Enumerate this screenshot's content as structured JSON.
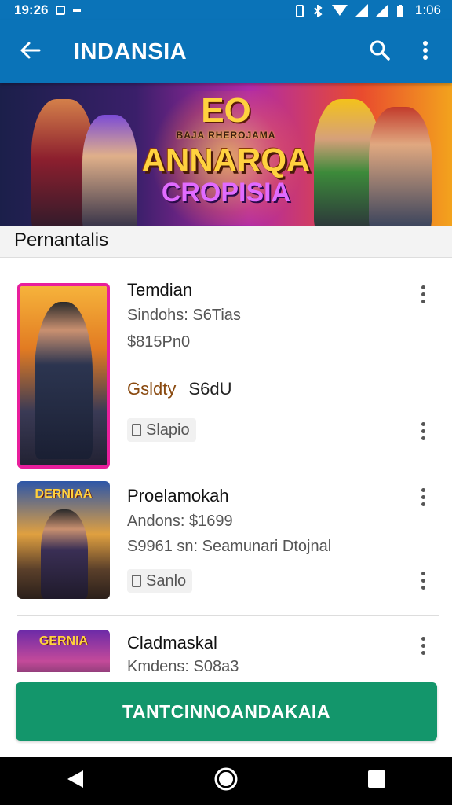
{
  "status_bar": {
    "time_left": "19:26",
    "time_right": "1:06"
  },
  "app_bar": {
    "title": "INDANSIA",
    "back_icon": "arrow-left-icon",
    "search_icon": "search-icon",
    "more_icon": "more-vert-icon"
  },
  "banner": {
    "line1": "EO",
    "line_small": "BAJA RHEROJAMA",
    "line2": "ANNARQA",
    "line3": "CROPISIA"
  },
  "section": {
    "title": "Pernantalis"
  },
  "items": [
    {
      "title": "Temdian",
      "line1": "Sindohs: S6Tias",
      "line2": "$815Pn0",
      "quality_label": "Gsldty",
      "quality_value": "S6dU",
      "chip": "Slapio"
    },
    {
      "thumb_label": "DERNIAA",
      "title": "Proelamokah",
      "line1": "Andons: $1699",
      "line2": "S9961 sn: Seamunari Dtojnal",
      "chip": "Sanlo"
    },
    {
      "thumb_label": "GERNIA",
      "title": "Cladmaskal",
      "line1": "Kmdens: S08a3"
    }
  ],
  "cta": {
    "label": "TANTCINNOANDAKAIA"
  },
  "colors": {
    "primary": "#0a73b8",
    "cta": "#13966b",
    "thumb_border": "#e91e9c"
  }
}
